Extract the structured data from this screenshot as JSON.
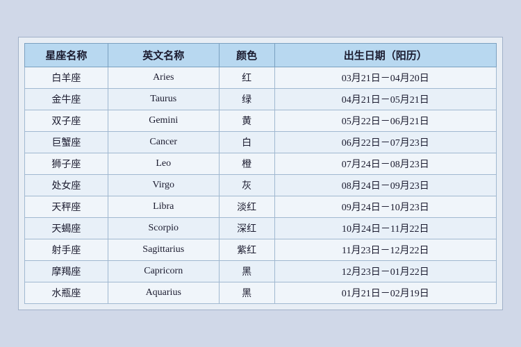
{
  "table": {
    "headers": [
      "星座名称",
      "英文名称",
      "颜色",
      "出生日期（阳历）"
    ],
    "rows": [
      {
        "zh": "白羊座",
        "en": "Aries",
        "color": "红",
        "date": "03月21日－04月20日"
      },
      {
        "zh": "金牛座",
        "en": "Taurus",
        "color": "绿",
        "date": "04月21日－05月21日"
      },
      {
        "zh": "双子座",
        "en": "Gemini",
        "color": "黄",
        "date": "05月22日－06月21日"
      },
      {
        "zh": "巨蟹座",
        "en": "Cancer",
        "color": "白",
        "date": "06月22日－07月23日"
      },
      {
        "zh": "狮子座",
        "en": "Leo",
        "color": "橙",
        "date": "07月24日－08月23日"
      },
      {
        "zh": "处女座",
        "en": "Virgo",
        "color": "灰",
        "date": "08月24日－09月23日"
      },
      {
        "zh": "天秤座",
        "en": "Libra",
        "color": "淡红",
        "date": "09月24日－10月23日"
      },
      {
        "zh": "天蝎座",
        "en": "Scorpio",
        "color": "深红",
        "date": "10月24日－11月22日"
      },
      {
        "zh": "射手座",
        "en": "Sagittarius",
        "color": "紫红",
        "date": "11月23日－12月22日"
      },
      {
        "zh": "摩羯座",
        "en": "Capricorn",
        "color": "黑",
        "date": "12月23日－01月22日"
      },
      {
        "zh": "水瓶座",
        "en": "Aquarius",
        "color": "黑",
        "date": "01月21日－02月19日"
      }
    ]
  }
}
